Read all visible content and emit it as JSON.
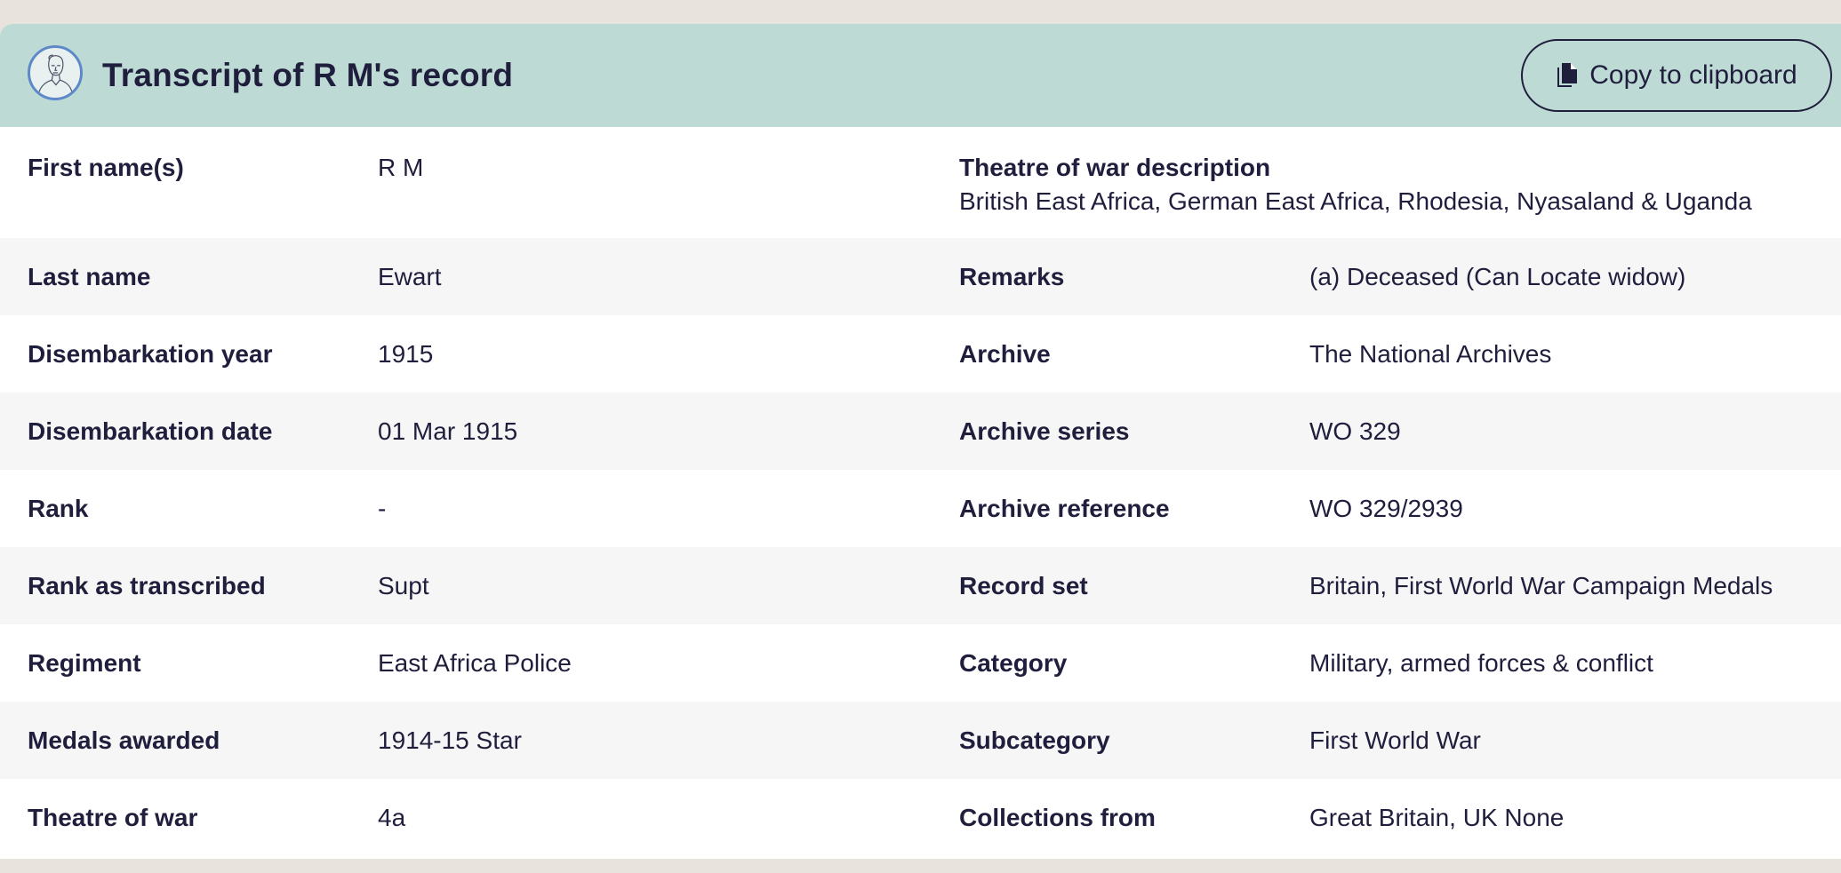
{
  "header": {
    "title": "Transcript of R M's record",
    "copy_label": "Copy to clipboard"
  },
  "rows": [
    {
      "left_label": "First name(s)",
      "left_value": "R M",
      "right_label": "Theatre of war description",
      "right_value": "British East Africa, German East Africa, Rhodesia, Nyasaland & Uganda"
    },
    {
      "left_label": "Last name",
      "left_value": "Ewart",
      "right_label": "Remarks",
      "right_value": "(a) Deceased (Can Locate widow)"
    },
    {
      "left_label": "Disembarkation year",
      "left_value": "1915",
      "right_label": "Archive",
      "right_value": "The National Archives"
    },
    {
      "left_label": "Disembarkation date",
      "left_value": "01 Mar 1915",
      "right_label": "Archive series",
      "right_value": "WO 329"
    },
    {
      "left_label": "Rank",
      "left_value": "-",
      "right_label": "Archive reference",
      "right_value": "WO 329/2939"
    },
    {
      "left_label": "Rank as transcribed",
      "left_value": "Supt",
      "right_label": "Record set",
      "right_value": "Britain, First World War Campaign Medals"
    },
    {
      "left_label": "Regiment",
      "left_value": "East Africa Police",
      "right_label": "Category",
      "right_value": "Military, armed forces & conflict"
    },
    {
      "left_label": "Medals awarded",
      "left_value": "1914-15 Star",
      "right_label": "Subcategory",
      "right_value": "First World War"
    },
    {
      "left_label": "Theatre of war",
      "left_value": "4a",
      "right_label": "Collections from",
      "right_value": "Great Britain, UK None"
    }
  ],
  "icons": {
    "avatar": "person-sketch-icon",
    "copy": "document-copy-icon"
  },
  "colors": {
    "header_bg": "#bedad4",
    "text": "#201e3d",
    "alt_row": "#f6f6f6",
    "page_bg": "#e8e3dd",
    "avatar_ring": "#5e89c9"
  }
}
